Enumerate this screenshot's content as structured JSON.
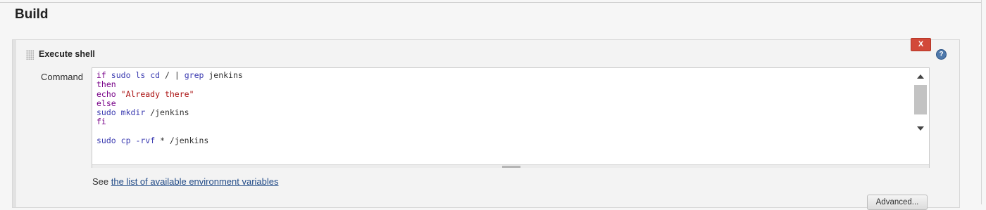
{
  "section": {
    "title": "Build"
  },
  "build_step": {
    "title": "Execute shell",
    "delete_label": "X",
    "help_label": "?",
    "command_label": "Command",
    "command_lines": [
      [
        {
          "t": "if",
          "c": "kw"
        },
        {
          "t": " "
        },
        {
          "t": "sudo",
          "c": "cmd"
        },
        {
          "t": " "
        },
        {
          "t": "ls",
          "c": "cmd"
        },
        {
          "t": " "
        },
        {
          "t": "cd",
          "c": "cmd"
        },
        {
          "t": " / | "
        },
        {
          "t": "grep",
          "c": "cmd"
        },
        {
          "t": " jenkins"
        }
      ],
      [
        {
          "t": "then",
          "c": "kw"
        }
      ],
      [
        {
          "t": "echo",
          "c": "kw"
        },
        {
          "t": " "
        },
        {
          "t": "\"Already there\"",
          "c": "str"
        }
      ],
      [
        {
          "t": "else",
          "c": "kw"
        }
      ],
      [
        {
          "t": "sudo",
          "c": "cmd"
        },
        {
          "t": " "
        },
        {
          "t": "mkdir",
          "c": "cmd"
        },
        {
          "t": " /jenkins"
        }
      ],
      [
        {
          "t": "fi",
          "c": "kw"
        }
      ],
      [
        {
          "t": ""
        }
      ],
      [
        {
          "t": "sudo",
          "c": "cmd"
        },
        {
          "t": " "
        },
        {
          "t": "cp",
          "c": "cmd"
        },
        {
          "t": " "
        },
        {
          "t": "-rvf",
          "c": "cmd"
        },
        {
          "t": " * /jenkins"
        }
      ]
    ],
    "see_text": "See ",
    "env_link_text": "the list of available environment variables",
    "advanced_label": "Advanced..."
  },
  "colors": {
    "keyword": "#770088",
    "command": "#3a3ab0",
    "string": "#aa1111",
    "delete_button": "#d24939",
    "link": "#204a87"
  }
}
